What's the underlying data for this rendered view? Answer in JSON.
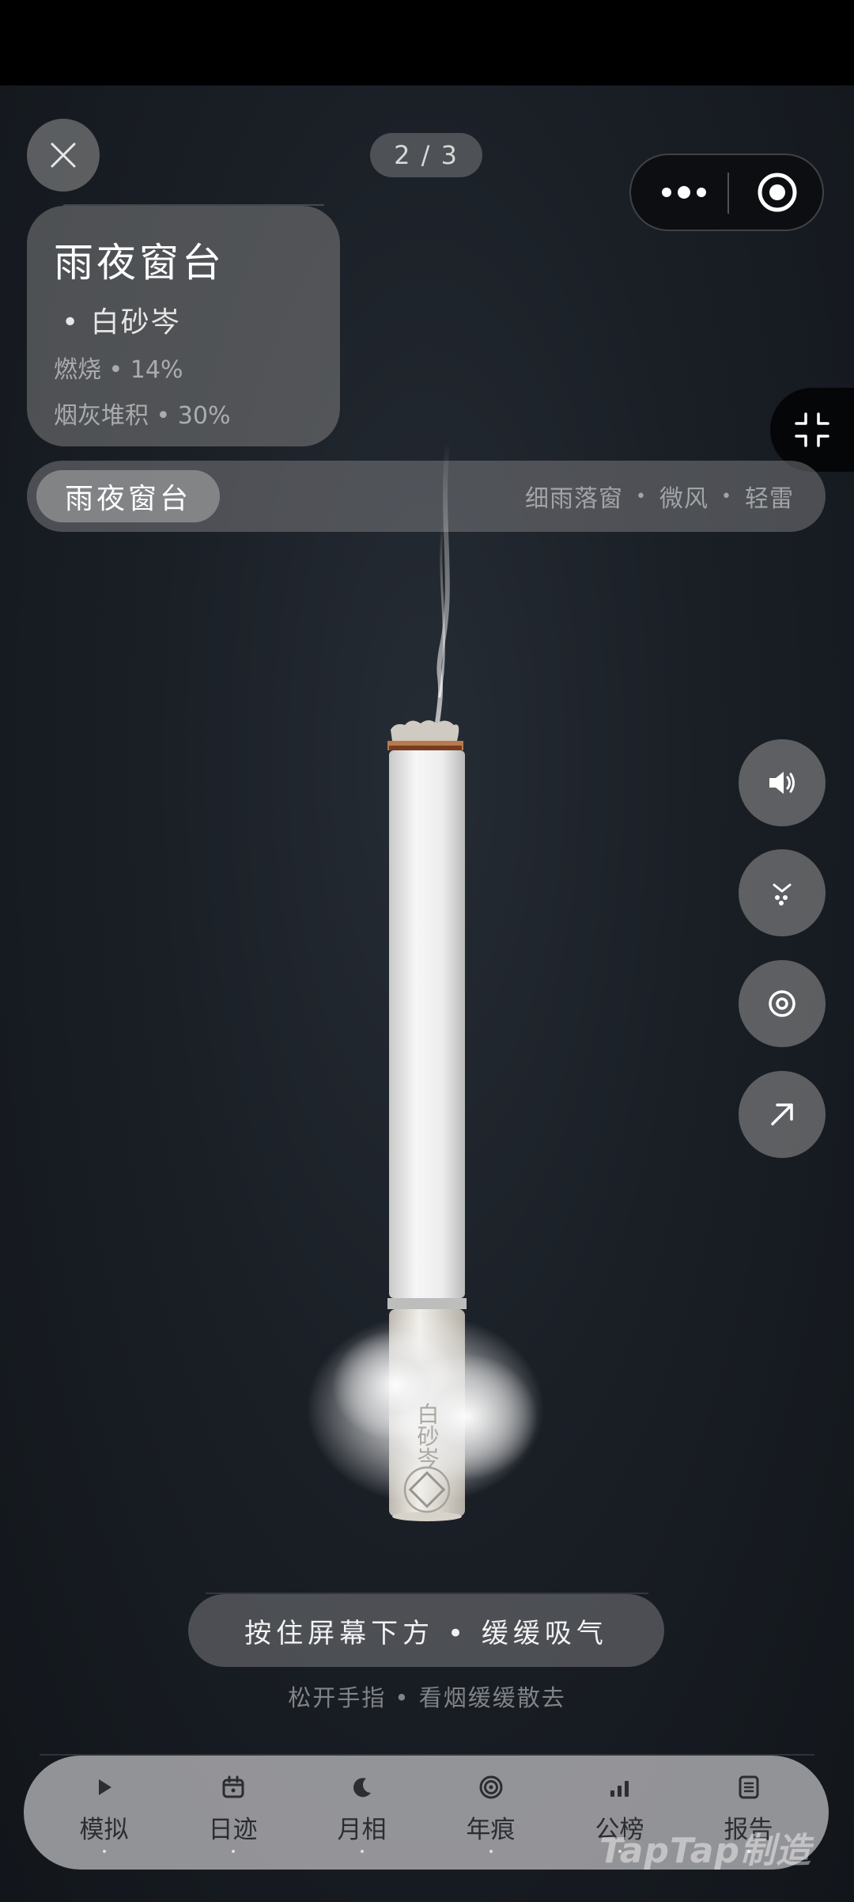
{
  "header": {
    "page_indicator": "2 / 3"
  },
  "info_card": {
    "title": "雨夜窗台",
    "brand": "•  白砂岑",
    "burn": "燃烧  •  14%",
    "ash": "烟灰堆积  •  30%",
    "burn_progress": 0.14,
    "ash_progress": 0.3
  },
  "scene": {
    "active": "雨夜窗台",
    "tags": [
      "细雨落窗",
      "微风",
      "轻雷"
    ]
  },
  "cigarette": {
    "brand_mark": "白砂岑"
  },
  "side_buttons": [
    {
      "icon": "speaker-icon"
    },
    {
      "icon": "ash-drop-icon"
    },
    {
      "icon": "target-icon"
    },
    {
      "icon": "share-arrow-icon"
    }
  ],
  "hint": {
    "main": "按住屏幕下方  •  缓缓吸气",
    "sub": "松开手指  •  看烟缓缓散去"
  },
  "nav": {
    "items": [
      {
        "label": "模拟",
        "icon": "play-icon"
      },
      {
        "label": "日迹",
        "icon": "calendar-icon"
      },
      {
        "label": "月相",
        "icon": "moon-icon"
      },
      {
        "label": "年痕",
        "icon": "ring-icon"
      },
      {
        "label": "公榜",
        "icon": "bars-icon"
      },
      {
        "label": "报告",
        "icon": "report-icon"
      }
    ]
  },
  "watermark": "TapTap制造",
  "colors": {
    "background": "#1a1f26",
    "panel": "#7d7d7d",
    "nav": "#afafb2",
    "filter_band": "#b87a4e"
  }
}
